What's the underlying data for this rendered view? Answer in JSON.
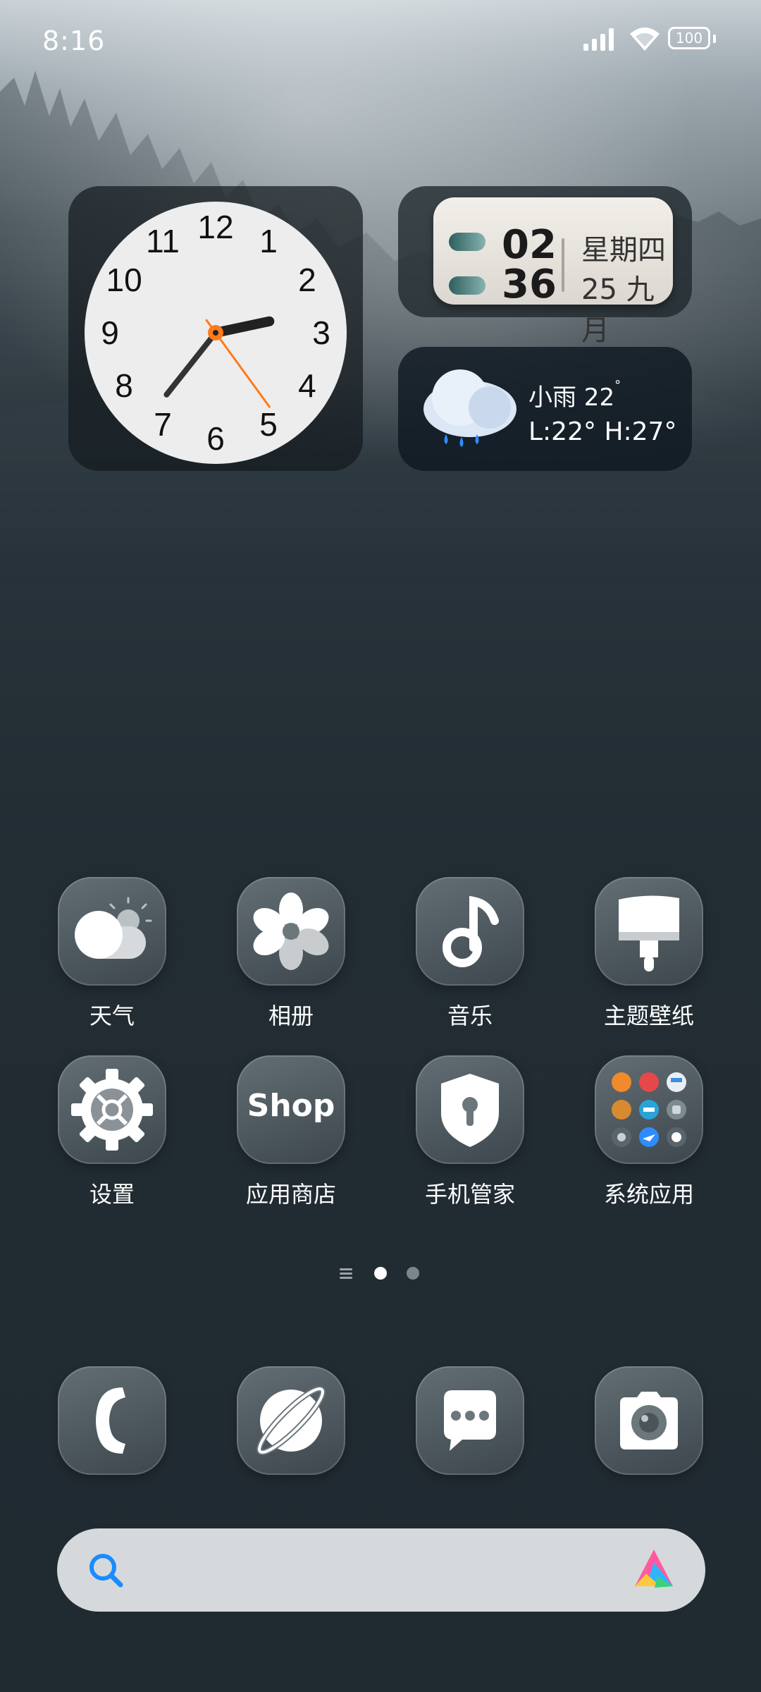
{
  "status_bar": {
    "time": "8:16",
    "battery": "100"
  },
  "clock_widget": {
    "hour": 2,
    "minute": 36,
    "second": 24,
    "numbers": [
      "12",
      "1",
      "2",
      "3",
      "4",
      "5",
      "6",
      "7",
      "8",
      "9",
      "10",
      "11"
    ]
  },
  "calendar_widget": {
    "hour_digits": "02",
    "minute_digits": "36",
    "weekday": "星期四",
    "date": "25 九月"
  },
  "weather_widget": {
    "condition_temp": "小雨 22",
    "unit": "°",
    "range": "L:22° H:27°"
  },
  "apps_row1": [
    {
      "label": "天气",
      "icon": "weather-icon"
    },
    {
      "label": "相册",
      "icon": "gallery-icon"
    },
    {
      "label": "音乐",
      "icon": "music-icon"
    },
    {
      "label": "主题壁纸",
      "icon": "themes-icon"
    }
  ],
  "apps_row2": [
    {
      "label": "设置",
      "icon": "settings-icon"
    },
    {
      "label": "应用商店",
      "icon": "shop-icon",
      "icon_text": "Shop"
    },
    {
      "label": "手机管家",
      "icon": "security-icon"
    },
    {
      "label": "系统应用",
      "icon": "folder-icon"
    }
  ],
  "page_indicator": {
    "pages": 2,
    "current": 1
  },
  "dock": [
    {
      "icon": "phone-icon"
    },
    {
      "icon": "browser-icon"
    },
    {
      "icon": "messages-icon"
    },
    {
      "icon": "camera-icon"
    }
  ],
  "search_bar": {
    "left_icon": "search-icon",
    "right_icon": "assistant-icon"
  },
  "colors": {
    "accent_orange": "#ff7a1a",
    "search_blue": "#1a8cff"
  }
}
